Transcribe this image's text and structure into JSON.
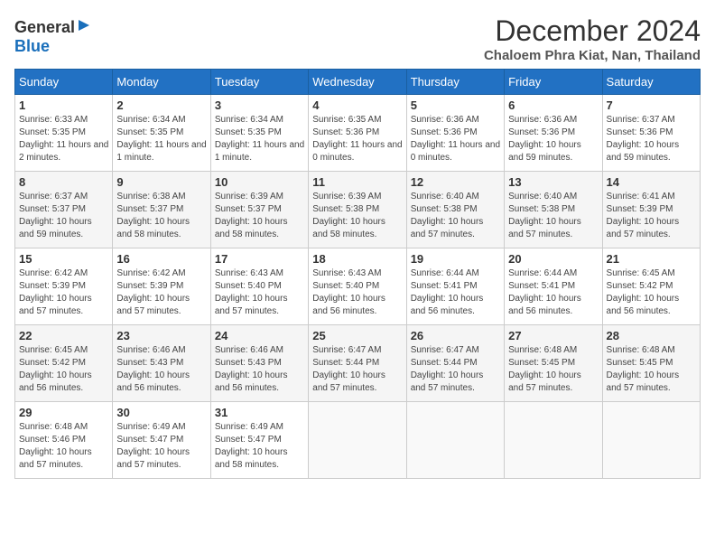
{
  "logo": {
    "general": "General",
    "blue": "Blue"
  },
  "title": {
    "month": "December 2024",
    "location": "Chaloem Phra Kiat, Nan, Thailand"
  },
  "headers": [
    "Sunday",
    "Monday",
    "Tuesday",
    "Wednesday",
    "Thursday",
    "Friday",
    "Saturday"
  ],
  "weeks": [
    [
      {
        "day": 1,
        "sunrise": "6:33 AM",
        "sunset": "5:35 PM",
        "daylight": "11 hours and 2 minutes."
      },
      {
        "day": 2,
        "sunrise": "6:34 AM",
        "sunset": "5:35 PM",
        "daylight": "11 hours and 1 minute."
      },
      {
        "day": 3,
        "sunrise": "6:34 AM",
        "sunset": "5:35 PM",
        "daylight": "11 hours and 1 minute."
      },
      {
        "day": 4,
        "sunrise": "6:35 AM",
        "sunset": "5:36 PM",
        "daylight": "11 hours and 0 minutes."
      },
      {
        "day": 5,
        "sunrise": "6:36 AM",
        "sunset": "5:36 PM",
        "daylight": "11 hours and 0 minutes."
      },
      {
        "day": 6,
        "sunrise": "6:36 AM",
        "sunset": "5:36 PM",
        "daylight": "10 hours and 59 minutes."
      },
      {
        "day": 7,
        "sunrise": "6:37 AM",
        "sunset": "5:36 PM",
        "daylight": "10 hours and 59 minutes."
      }
    ],
    [
      {
        "day": 8,
        "sunrise": "6:37 AM",
        "sunset": "5:37 PM",
        "daylight": "10 hours and 59 minutes."
      },
      {
        "day": 9,
        "sunrise": "6:38 AM",
        "sunset": "5:37 PM",
        "daylight": "10 hours and 58 minutes."
      },
      {
        "day": 10,
        "sunrise": "6:39 AM",
        "sunset": "5:37 PM",
        "daylight": "10 hours and 58 minutes."
      },
      {
        "day": 11,
        "sunrise": "6:39 AM",
        "sunset": "5:38 PM",
        "daylight": "10 hours and 58 minutes."
      },
      {
        "day": 12,
        "sunrise": "6:40 AM",
        "sunset": "5:38 PM",
        "daylight": "10 hours and 57 minutes."
      },
      {
        "day": 13,
        "sunrise": "6:40 AM",
        "sunset": "5:38 PM",
        "daylight": "10 hours and 57 minutes."
      },
      {
        "day": 14,
        "sunrise": "6:41 AM",
        "sunset": "5:39 PM",
        "daylight": "10 hours and 57 minutes."
      }
    ],
    [
      {
        "day": 15,
        "sunrise": "6:42 AM",
        "sunset": "5:39 PM",
        "daylight": "10 hours and 57 minutes."
      },
      {
        "day": 16,
        "sunrise": "6:42 AM",
        "sunset": "5:39 PM",
        "daylight": "10 hours and 57 minutes."
      },
      {
        "day": 17,
        "sunrise": "6:43 AM",
        "sunset": "5:40 PM",
        "daylight": "10 hours and 57 minutes."
      },
      {
        "day": 18,
        "sunrise": "6:43 AM",
        "sunset": "5:40 PM",
        "daylight": "10 hours and 56 minutes."
      },
      {
        "day": 19,
        "sunrise": "6:44 AM",
        "sunset": "5:41 PM",
        "daylight": "10 hours and 56 minutes."
      },
      {
        "day": 20,
        "sunrise": "6:44 AM",
        "sunset": "5:41 PM",
        "daylight": "10 hours and 56 minutes."
      },
      {
        "day": 21,
        "sunrise": "6:45 AM",
        "sunset": "5:42 PM",
        "daylight": "10 hours and 56 minutes."
      }
    ],
    [
      {
        "day": 22,
        "sunrise": "6:45 AM",
        "sunset": "5:42 PM",
        "daylight": "10 hours and 56 minutes."
      },
      {
        "day": 23,
        "sunrise": "6:46 AM",
        "sunset": "5:43 PM",
        "daylight": "10 hours and 56 minutes."
      },
      {
        "day": 24,
        "sunrise": "6:46 AM",
        "sunset": "5:43 PM",
        "daylight": "10 hours and 56 minutes."
      },
      {
        "day": 25,
        "sunrise": "6:47 AM",
        "sunset": "5:44 PM",
        "daylight": "10 hours and 57 minutes."
      },
      {
        "day": 26,
        "sunrise": "6:47 AM",
        "sunset": "5:44 PM",
        "daylight": "10 hours and 57 minutes."
      },
      {
        "day": 27,
        "sunrise": "6:48 AM",
        "sunset": "5:45 PM",
        "daylight": "10 hours and 57 minutes."
      },
      {
        "day": 28,
        "sunrise": "6:48 AM",
        "sunset": "5:45 PM",
        "daylight": "10 hours and 57 minutes."
      }
    ],
    [
      {
        "day": 29,
        "sunrise": "6:48 AM",
        "sunset": "5:46 PM",
        "daylight": "10 hours and 57 minutes."
      },
      {
        "day": 30,
        "sunrise": "6:49 AM",
        "sunset": "5:47 PM",
        "daylight": "10 hours and 57 minutes."
      },
      {
        "day": 31,
        "sunrise": "6:49 AM",
        "sunset": "5:47 PM",
        "daylight": "10 hours and 58 minutes."
      },
      null,
      null,
      null,
      null
    ]
  ]
}
